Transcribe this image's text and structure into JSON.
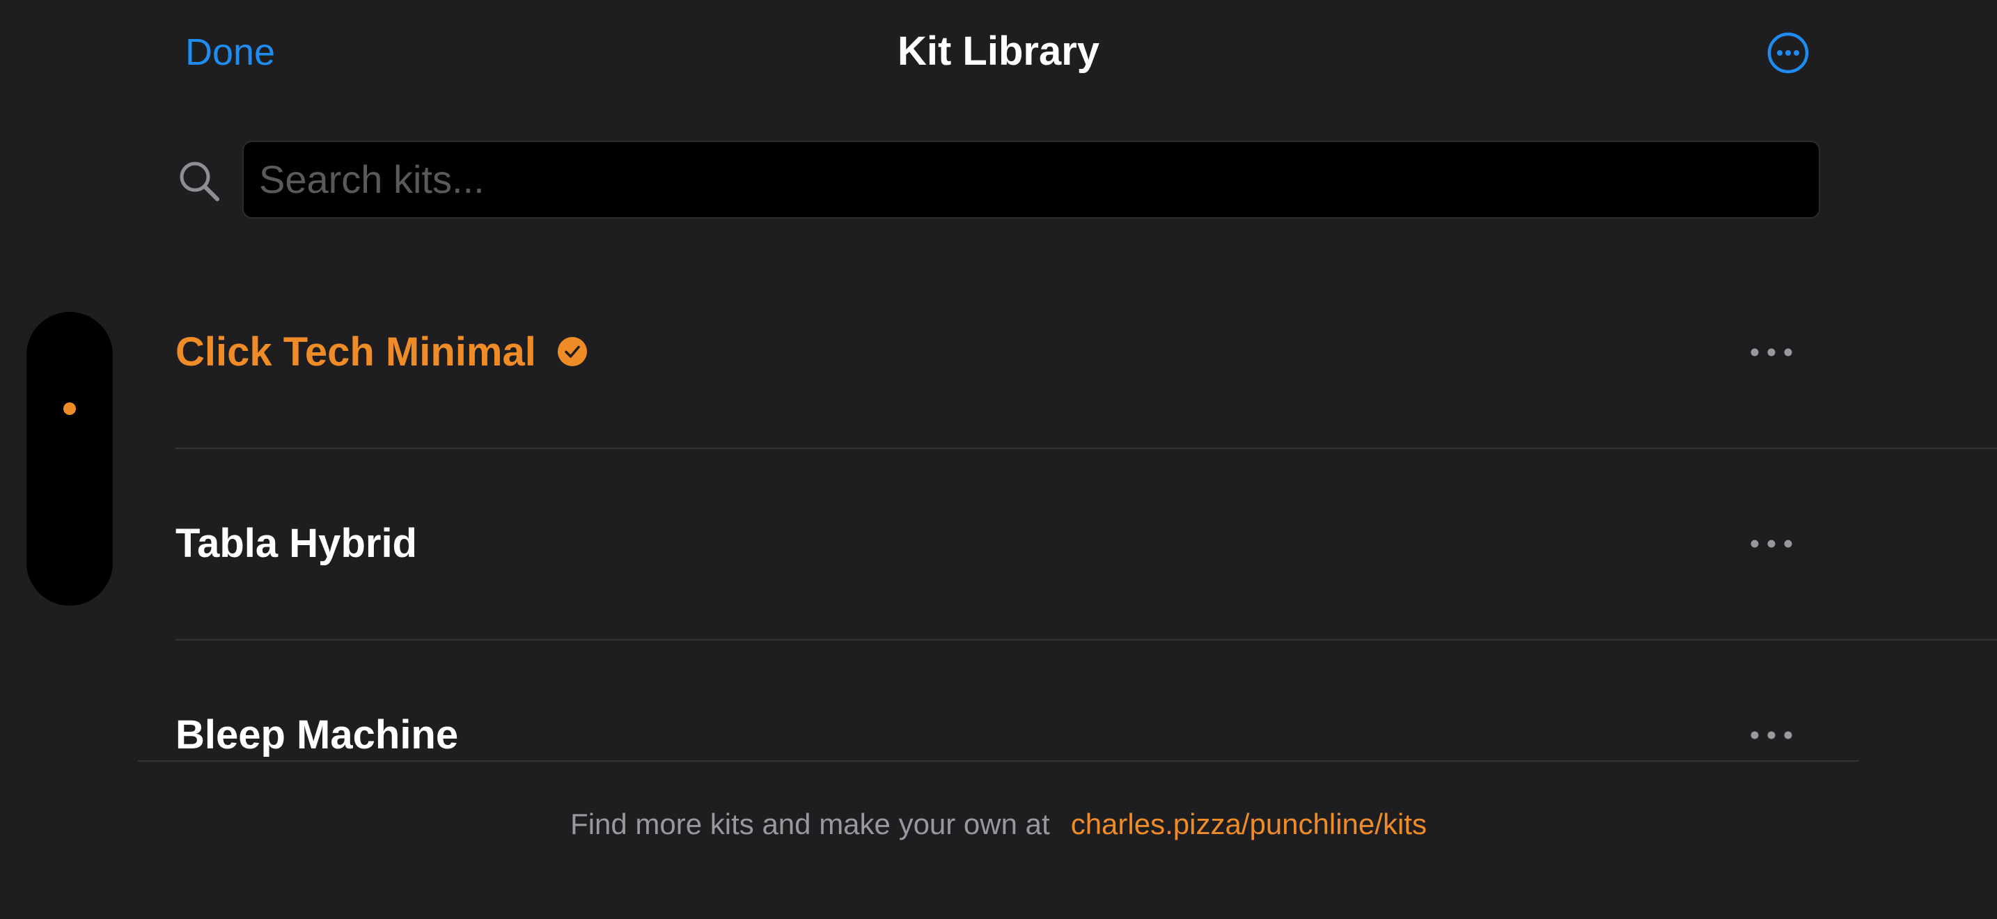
{
  "header": {
    "done_label": "Done",
    "title": "Kit Library",
    "more_icon": "ellipsis-circle-icon"
  },
  "search": {
    "placeholder": "Search kits...",
    "value": "",
    "icon": "search-icon"
  },
  "kits": [
    {
      "name": "Click Tech Minimal",
      "selected": true,
      "badge_icon": "checkmark-circle-icon"
    },
    {
      "name": "Tabla Hybrid",
      "selected": false
    },
    {
      "name": "Bleep Machine",
      "selected": false
    }
  ],
  "footer": {
    "text": "Find more kits and make your own at",
    "link": "charles.pizza/punchline/kits"
  },
  "colors": {
    "background": "#1e1e20",
    "accent_blue": "#1e8cf0",
    "accent_orange": "#f08c28",
    "text_primary": "#ffffff",
    "text_secondary": "#98989d"
  }
}
